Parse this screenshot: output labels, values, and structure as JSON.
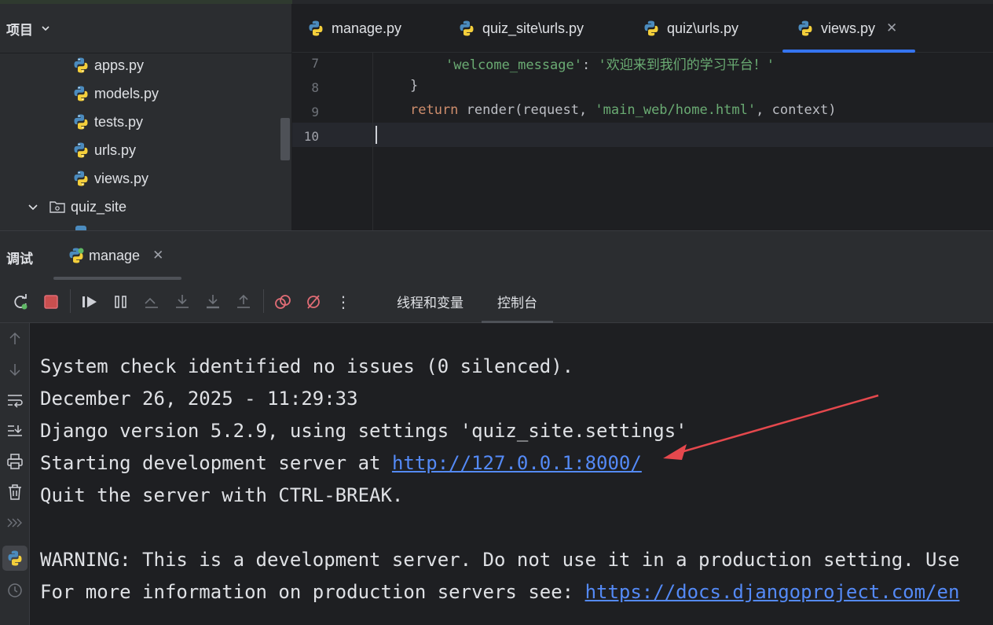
{
  "project": {
    "title": "项目",
    "items": [
      {
        "label": "apps.py",
        "icon": "python-file-icon"
      },
      {
        "label": "models.py",
        "icon": "python-file-icon"
      },
      {
        "label": "tests.py",
        "icon": "python-file-icon"
      },
      {
        "label": "urls.py",
        "icon": "python-file-icon"
      },
      {
        "label": "views.py",
        "icon": "python-file-icon"
      },
      {
        "label": "quiz_site",
        "icon": "folder-icon"
      }
    ]
  },
  "editor": {
    "tabs": [
      {
        "label": "manage.py"
      },
      {
        "label": "quiz_site\\urls.py"
      },
      {
        "label": "quiz\\urls.py"
      },
      {
        "label": "views.py",
        "active": true
      }
    ],
    "close_glyph": "✕",
    "line_numbers": [
      "7",
      "8",
      "9",
      "10"
    ],
    "code": {
      "line7_key": "'welcome_message'",
      "line7_sep": ": ",
      "line7_val": "'欢迎来到我们的学习平台！'",
      "line8": "}",
      "line9_kw": "return",
      "line9_mid": " render(request, ",
      "line9_str": "'main_web/home.html'",
      "line9_end": ", context)"
    }
  },
  "debug": {
    "title": "调试",
    "run_tab": "manage",
    "close_glyph": "✕",
    "subtabs": {
      "threads": "线程和变量",
      "console": "控制台"
    },
    "more_glyph": "⋮"
  },
  "console": {
    "line1": "System check identified no issues (0 silenced).",
    "line2": "December 26, 2025 - 11:29:33",
    "line3": "Django version 5.2.9, using settings 'quiz_site.settings'",
    "line4_prefix": "Starting development server at ",
    "line4_link": "http://127.0.0.1:8000/",
    "line5": "Quit the server with CTRL-BREAK.",
    "line6": "WARNING: This is a development server. Do not use it in a production setting. Use",
    "line7_prefix": "For more information on production servers see: ",
    "line7_link": "https://docs.djangoproject.com/en"
  },
  "colors": {
    "accent": "#3574f0",
    "link": "#548af7",
    "stop": "#e06c75",
    "annotation_arrow": "#e5484d"
  }
}
